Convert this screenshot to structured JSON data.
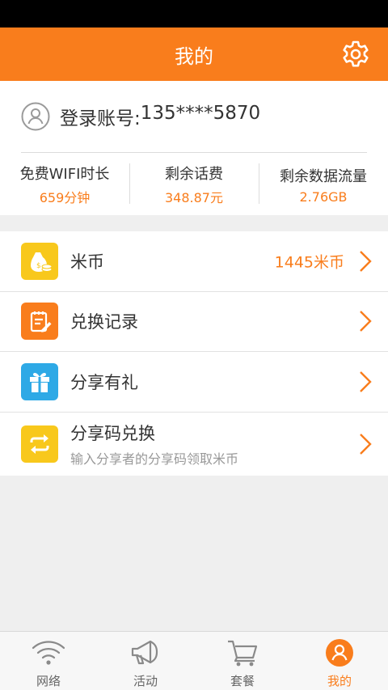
{
  "header": {
    "title": "我的"
  },
  "account": {
    "label": "登录账号:",
    "phone": "135****5870"
  },
  "stats": [
    {
      "label": "免费WIFI时长",
      "value": "659分钟"
    },
    {
      "label": "剩余话费",
      "value": "348.87元"
    },
    {
      "label": "剩余数据流量",
      "value": "2.76GB"
    }
  ],
  "menu": [
    {
      "label": "米币",
      "value": "1445米币",
      "icon": "coin-bag-icon",
      "color": "#f8c81c"
    },
    {
      "label": "兑换记录",
      "icon": "notepad-icon",
      "color": "#f97d1c"
    },
    {
      "label": "分享有礼",
      "icon": "gift-icon",
      "color": "#2ea9e6"
    },
    {
      "label": "分享码兑换",
      "sub": "输入分享者的分享码领取米币",
      "icon": "exchange-icon",
      "color": "#f8c81c"
    }
  ],
  "nav": [
    {
      "label": "网络",
      "icon": "wifi-icon"
    },
    {
      "label": "活动",
      "icon": "megaphone-icon"
    },
    {
      "label": "套餐",
      "icon": "cart-icon"
    },
    {
      "label": "我的",
      "icon": "profile-icon",
      "active": true
    }
  ],
  "colors": {
    "accent": "#f97d1c",
    "yellow": "#f8c81c",
    "blue": "#2ea9e6"
  }
}
